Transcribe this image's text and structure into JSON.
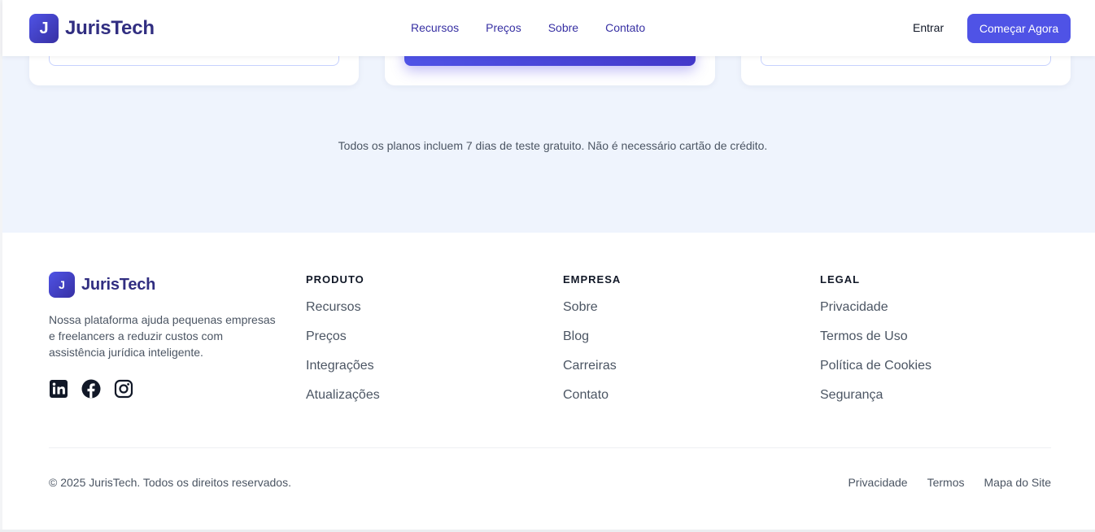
{
  "brand": {
    "logo_letter": "J",
    "name": "JurisTech"
  },
  "nav": {
    "links": [
      "Recursos",
      "Preços",
      "Sobre",
      "Contato"
    ],
    "signin_label": "Entrar",
    "cta_label": "Começar Agora"
  },
  "pricing": {
    "trial_note": "Todos os planos incluem 7 dias de teste gratuito. Não é necessário cartão de crédito."
  },
  "footer": {
    "logo_letter": "J",
    "name": "JurisTech",
    "description": "Nossa plataforma ajuda pequenas empresas e freelancers a reduzir custos com assistência jurídica inteligente.",
    "socials": [
      "linkedin-icon",
      "facebook-icon",
      "instagram-icon"
    ],
    "columns": {
      "produto": {
        "title": "PRODUTO",
        "links": [
          "Recursos",
          "Preços",
          "Integrações",
          "Atualizações"
        ]
      },
      "empresa": {
        "title": "EMPRESA",
        "links": [
          "Sobre",
          "Blog",
          "Carreiras",
          "Contato"
        ]
      },
      "legal": {
        "title": "LEGAL",
        "links": [
          "Privacidade",
          "Termos de Uso",
          "Política de Cookies",
          "Segurança"
        ]
      }
    },
    "copyright": "© 2025 JurisTech. Todos os direitos reservados.",
    "bottom_links": [
      "Privacidade",
      "Termos",
      "Mapa do Site"
    ]
  },
  "colors": {
    "primary": "#4f53e6",
    "brand_text": "#312e81",
    "nav_text": "#3730a3",
    "section_bg": "#eff4fd"
  }
}
